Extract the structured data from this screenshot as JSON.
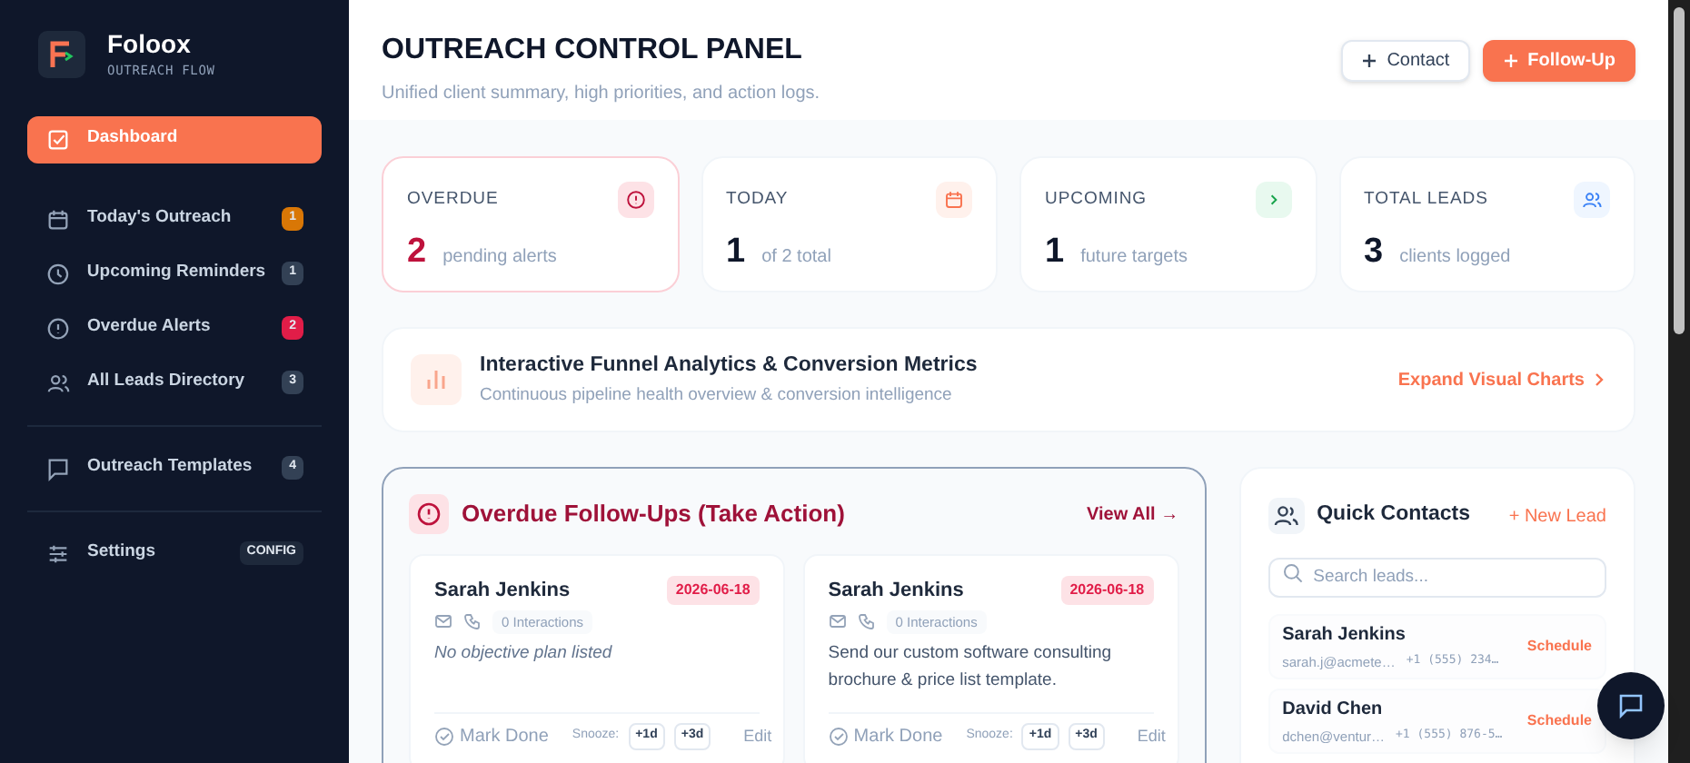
{
  "brand": {
    "name": "Foloox",
    "tagline": "OUTREACH FLOW"
  },
  "nav": [
    {
      "label": "Dashboard",
      "selected": true
    },
    {
      "label": "Today's Outreach",
      "badge": "1",
      "color": "#d97706",
      "selected": false
    },
    {
      "label": "Upcoming Reminders",
      "badge": "1",
      "color": "#334155",
      "selected": false
    },
    {
      "label": "Overdue Alerts",
      "badge": "2",
      "color": "#e11d48",
      "selected": false
    },
    {
      "label": "All Leads Directory",
      "badge": "3",
      "color": "#334155",
      "selected": false
    },
    {
      "label": "Outreach Templates",
      "badge": "4",
      "color": "#334155",
      "selected": false,
      "divider_before": true
    },
    {
      "label": "Settings",
      "badge": "CONFIG",
      "color": "#1e293b",
      "selected": false,
      "divider_before": true
    }
  ],
  "header": {
    "title": "OUTREACH CONTROL PANEL",
    "subtitle": "Unified client summary, high priorities, and action logs.",
    "buttons": [
      {
        "label": "Contact",
        "kind": "secondary"
      },
      {
        "label": "Follow-Up",
        "kind": "primary"
      }
    ]
  },
  "stats": [
    {
      "label": "OVERDUE",
      "value": "2",
      "caption": "pending alerts",
      "highlight": true
    },
    {
      "label": "TODAY",
      "value": "1",
      "caption": "of 2 total",
      "highlight": false
    },
    {
      "label": "UPCOMING",
      "value": "1",
      "caption": "future targets",
      "highlight": false
    },
    {
      "label": "TOTAL LEADS",
      "value": "3",
      "caption": "clients logged",
      "highlight": false
    }
  ],
  "funnel": {
    "title": "Interactive Funnel Analytics & Conversion Metrics",
    "subtitle": "Continuous pipeline health overview & conversion intelligence",
    "link": "Expand Visual Charts"
  },
  "overdue": {
    "title": "Overdue Follow-Ups (Take Action)",
    "link": "View All →",
    "cards": [
      {
        "name": "Sarah Jenkins",
        "date": "2026-06-18",
        "interactions": "0 Interactions",
        "note": "No objective plan listed",
        "note_empty": true,
        "done": "Mark Done",
        "snooze": "Snooze:",
        "snooze_options": [
          "+1d",
          "+3d"
        ],
        "edit": "Edit"
      },
      {
        "name": "Sarah Jenkins",
        "date": "2026-06-18",
        "interactions": "0 Interactions",
        "note": "Send our custom software consulting brochure & price list template.",
        "note_empty": false,
        "done": "Mark Done",
        "snooze": "Snooze:",
        "snooze_options": [
          "+1d",
          "+3d"
        ],
        "edit": "Edit"
      }
    ]
  },
  "contacts": {
    "title": "Quick Contacts",
    "link": "+ New Lead",
    "search": {
      "placeholder": "Search leads..."
    },
    "items": [
      {
        "name": "Sarah Jenkins",
        "email": "sarah.j@acmete…",
        "phone": "+1 (555) 234…",
        "action": "Schedule"
      },
      {
        "name": "David Chen",
        "email": "dchen@ventur…",
        "phone": "+1 (555) 876-5…",
        "action": "Schedule"
      }
    ]
  }
}
